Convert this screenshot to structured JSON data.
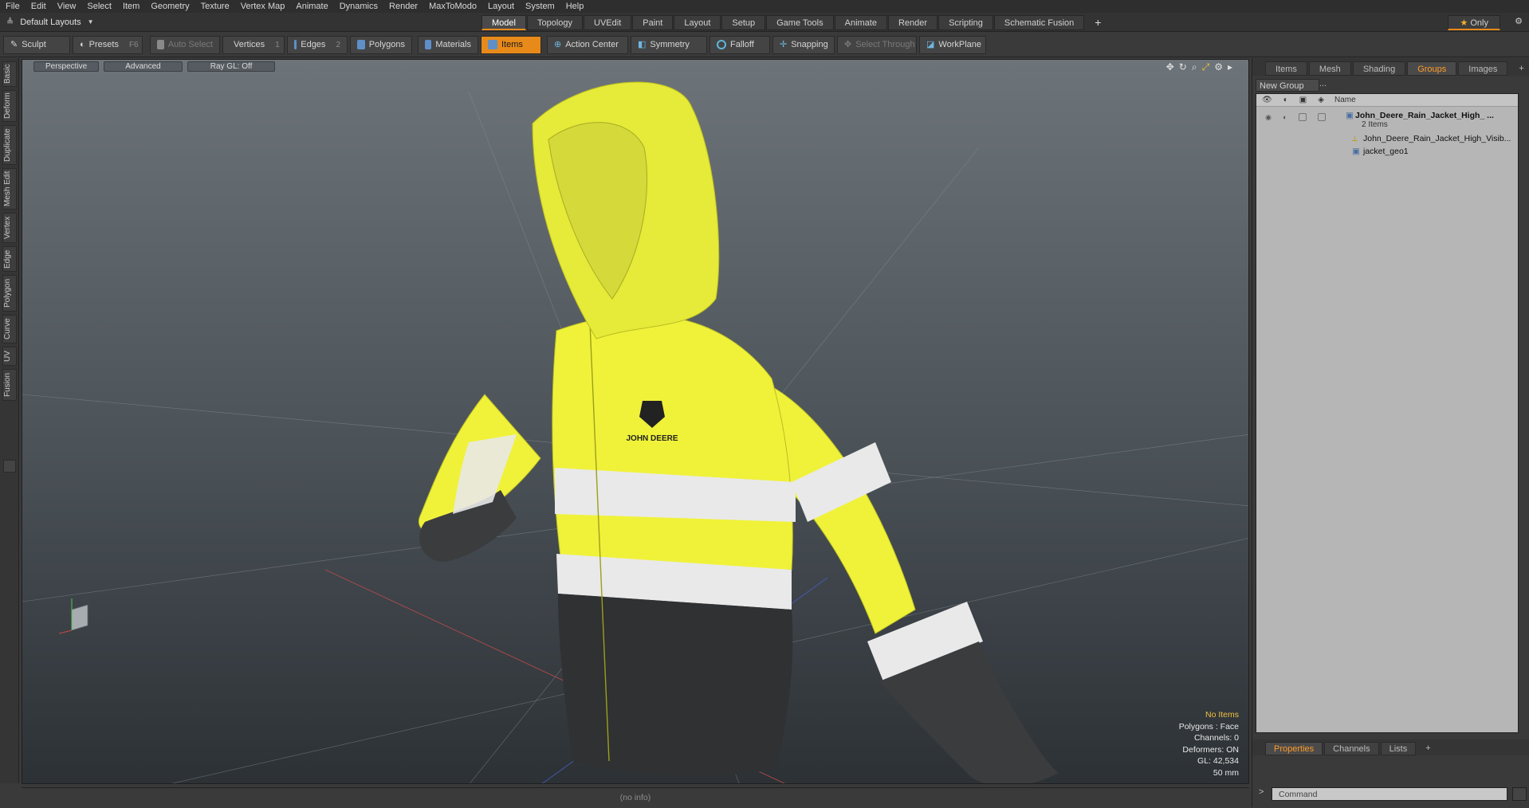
{
  "menu": [
    "File",
    "Edit",
    "View",
    "Select",
    "Item",
    "Geometry",
    "Texture",
    "Vertex Map",
    "Animate",
    "Dynamics",
    "Render",
    "MaxToModo",
    "Layout",
    "System",
    "Help"
  ],
  "layout_selector": "Default Layouts",
  "tabs": [
    "Model",
    "Topology",
    "UVEdit",
    "Paint",
    "Layout",
    "Setup",
    "Game Tools",
    "Animate",
    "Render",
    "Scripting",
    "Schematic Fusion"
  ],
  "active_tab": "Model",
  "only_label": "Only",
  "toolbar": {
    "sculpt": "Sculpt",
    "presets": "Presets",
    "presets_key": "F6",
    "auto_select": "Auto Select",
    "vertices": "Vertices",
    "vertices_key": "1",
    "edges": "Edges",
    "edges_key": "2",
    "polygons": "Polygons",
    "materials": "Materials",
    "items": "Items",
    "action_center": "Action Center",
    "symmetry": "Symmetry",
    "falloff": "Falloff",
    "snapping": "Snapping",
    "select_through": "Select Through",
    "workplane": "WorkPlane"
  },
  "side_tabs": [
    "Basic",
    "Deform",
    "Duplicate",
    "Mesh Edit",
    "Vertex",
    "Edge",
    "Polygon",
    "Curve",
    "UV",
    "Fusion"
  ],
  "viewport": {
    "view": "Perspective",
    "mode": "Advanced",
    "raygl": "Ray GL: Off",
    "logo_text": "JOHN DEERE",
    "stats": {
      "selection": "No Items",
      "polygons": "Polygons : Face",
      "channels": "Channels: 0",
      "deformers": "Deformers: ON",
      "gl": "GL: 42,534",
      "unit": "50 mm"
    }
  },
  "status_text": "(no info)",
  "panel": {
    "tabs": [
      "Items",
      "Mesh ...",
      "Shading",
      "Groups",
      "Images"
    ],
    "active_tab": "Groups",
    "new_group": "New Group",
    "column_name": "Name",
    "group_name": "John_Deere_Rain_Jacket_High_ ...",
    "group_count": "2 Items",
    "child1": "John_Deere_Rain_Jacket_High_Visib...",
    "child2": "jacket_geo1"
  },
  "bottom_tabs": [
    "Properties",
    "Channels",
    "Lists"
  ],
  "bottom_active": "Properties",
  "command_placeholder": "Command"
}
